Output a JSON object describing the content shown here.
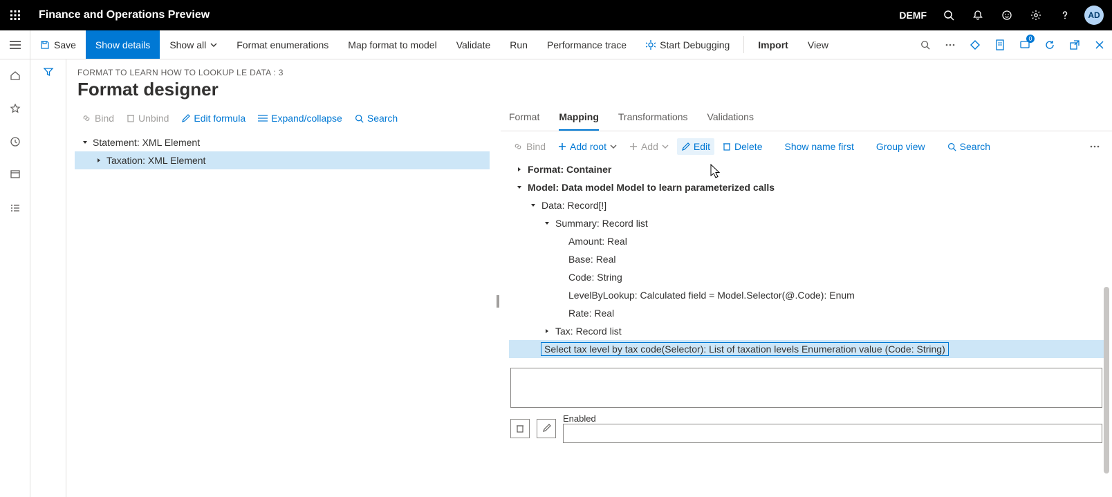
{
  "topbar": {
    "title": "Finance and Operations Preview",
    "company": "DEMF",
    "avatar": "AD"
  },
  "cmdbar": {
    "save": "Save",
    "show_details": "Show details",
    "show_all": "Show all",
    "format_enum": "Format enumerations",
    "map_format": "Map format to model",
    "validate": "Validate",
    "run": "Run",
    "perf": "Performance trace",
    "debug": "Start Debugging",
    "import": "Import",
    "view": "View",
    "badge_count": "0"
  },
  "page": {
    "breadcrumb": "FORMAT TO LEARN HOW TO LOOKUP LE DATA : 3",
    "title": "Format designer"
  },
  "left_toolbar": {
    "bind": "Bind",
    "unbind": "Unbind",
    "edit_formula": "Edit formula",
    "expand": "Expand/collapse",
    "search": "Search"
  },
  "format_tree": [
    {
      "label": "Statement: XML Element",
      "indent": 0,
      "expand": "open",
      "selected": false
    },
    {
      "label": "Taxation: XML Element",
      "indent": 1,
      "expand": "closed",
      "selected": true
    }
  ],
  "tabs": {
    "format": "Format",
    "mapping": "Mapping",
    "transforms": "Transformations",
    "valid": "Validations"
  },
  "rp_toolbar": {
    "bind": "Bind",
    "add_root": "Add root",
    "add": "Add",
    "edit": "Edit",
    "delete": "Delete",
    "show_name": "Show name first",
    "group_view": "Group view",
    "search": "Search"
  },
  "ds_tree": [
    {
      "label": "Format: Container",
      "indent": 0,
      "expand": "closed",
      "bold": true
    },
    {
      "label": "Model: Data model Model to learn parameterized calls",
      "indent": 0,
      "expand": "open",
      "bold": true
    },
    {
      "label": "Data: Record[!]",
      "indent": 1,
      "expand": "open"
    },
    {
      "label": "Summary: Record list",
      "indent": 2,
      "expand": "open"
    },
    {
      "label": "Amount: Real",
      "indent": 3
    },
    {
      "label": "Base: Real",
      "indent": 3
    },
    {
      "label": "Code: String",
      "indent": 3
    },
    {
      "label": "LevelByLookup: Calculated field = Model.Selector(@.Code): Enum",
      "indent": 3
    },
    {
      "label": "Rate: Real",
      "indent": 3
    },
    {
      "label": "Tax: Record list",
      "indent": 2,
      "expand": "closed"
    },
    {
      "label": "Select tax level by tax code(Selector): List of taxation levels Enumeration value (Code: String)",
      "indent": 1,
      "selected": true
    }
  ],
  "detail": {
    "enabled_label": "Enabled"
  }
}
